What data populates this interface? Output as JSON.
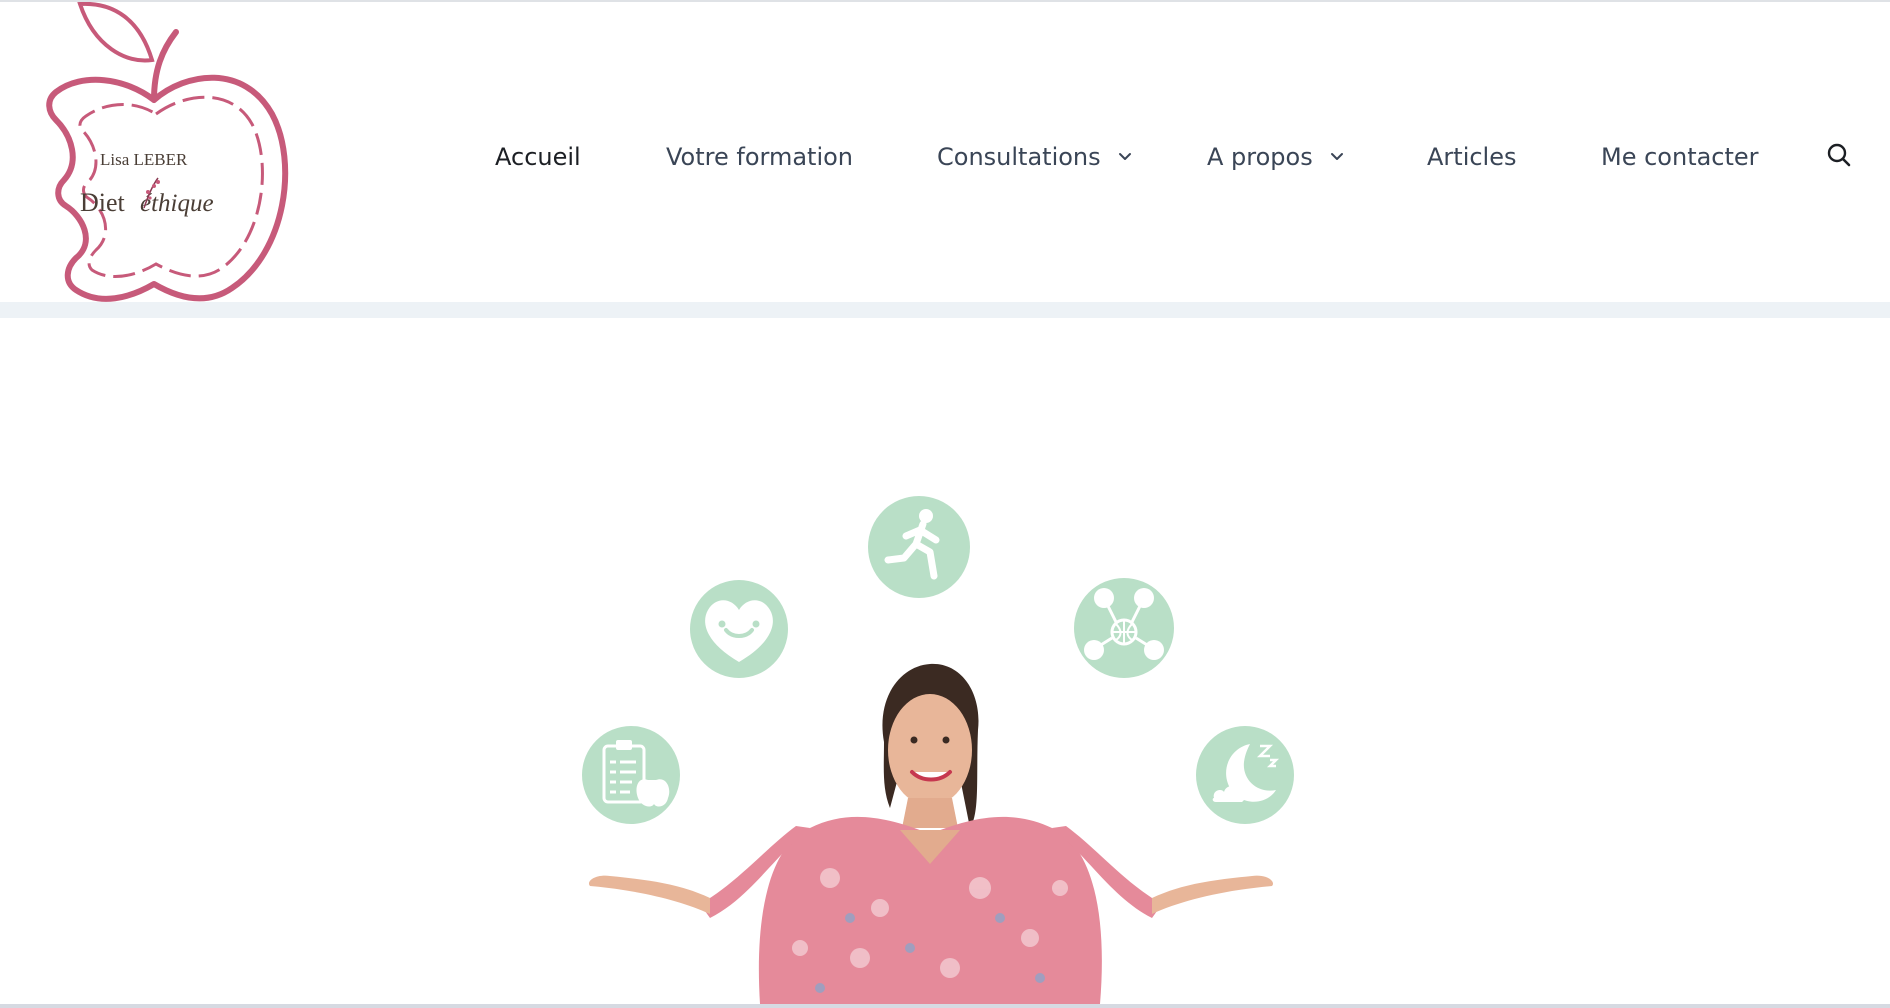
{
  "brand": {
    "name_line1": "Lisa LEBER",
    "name_line2_part1": "Diet",
    "name_line2_part2": "éthique",
    "logo_color": "#c75a7a"
  },
  "nav": {
    "items": [
      {
        "label": "Accueil",
        "active": true,
        "has_dropdown": false
      },
      {
        "label": "Votre formation",
        "active": false,
        "has_dropdown": false
      },
      {
        "label": "Consultations",
        "active": false,
        "has_dropdown": true
      },
      {
        "label": "A propos",
        "active": false,
        "has_dropdown": true
      },
      {
        "label": "Articles",
        "active": false,
        "has_dropdown": false
      },
      {
        "label": "Me contacter",
        "active": false,
        "has_dropdown": false
      }
    ],
    "search_icon": "search-icon"
  },
  "hero": {
    "icons": [
      "runner-icon",
      "heart-smile-icon",
      "network-icon",
      "checklist-apple-icon",
      "moon-sleep-icon"
    ],
    "icon_color": "#b9dfc7",
    "background": "#ffffff"
  },
  "colors": {
    "nav_text": "#3a4556",
    "nav_active": "#1c1f24",
    "band": "#edf2f6"
  }
}
